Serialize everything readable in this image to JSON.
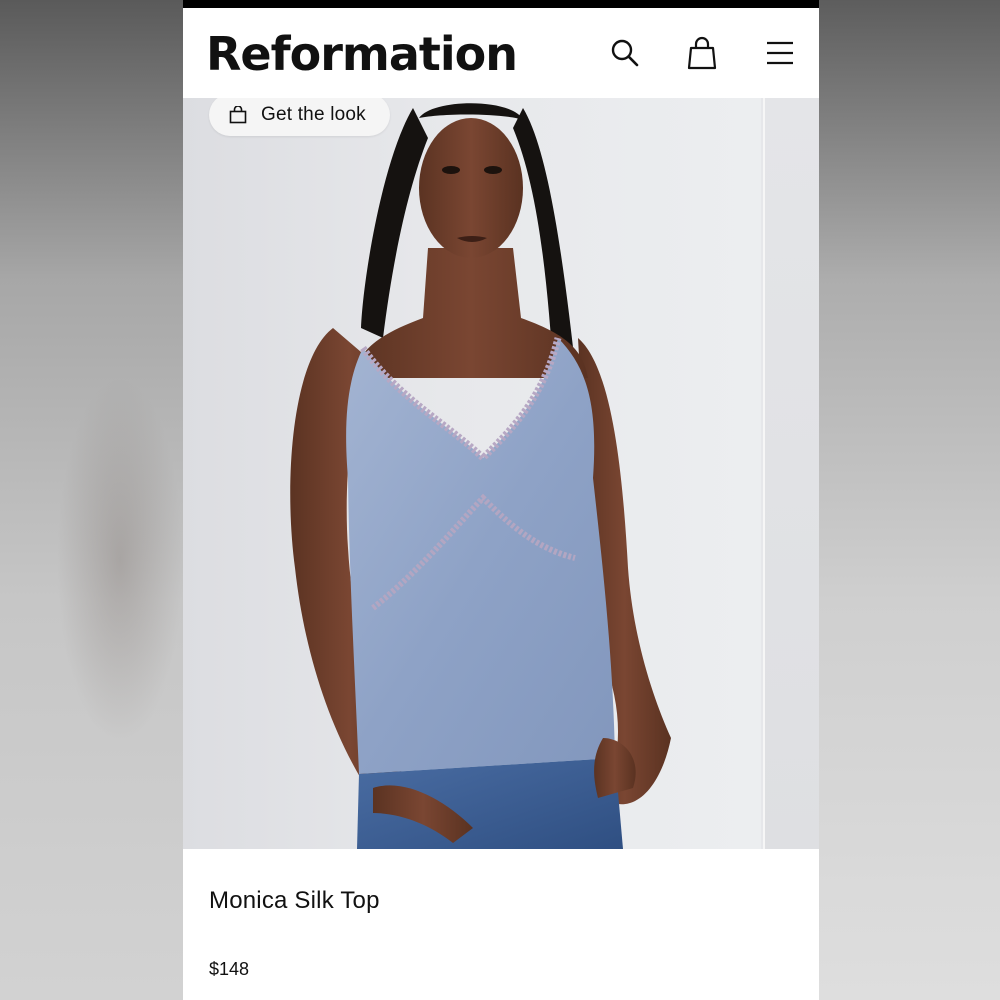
{
  "header": {
    "brand": "Reformation",
    "icons": {
      "search": "search-icon",
      "bag": "shopping-bag-icon",
      "menu": "hamburger-menu-icon"
    }
  },
  "gallery": {
    "get_the_look_label": "Get the look",
    "get_the_look_icon": "shopping-bag-icon"
  },
  "product": {
    "name": "Monica Silk Top",
    "price": "$148"
  },
  "colors": {
    "garment_blue": "#93a6c8",
    "denim": "#3d5f95",
    "text": "#111111",
    "background": "#ffffff"
  }
}
